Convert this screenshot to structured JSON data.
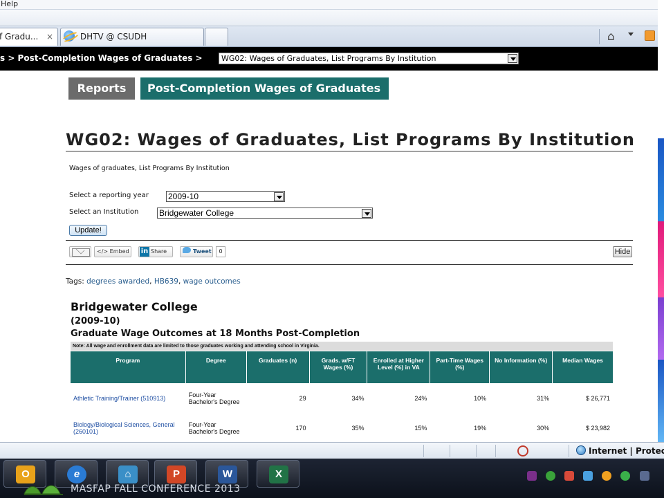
{
  "browser": {
    "menu_help": "Help",
    "tabs": [
      {
        "label": "f Gradu...",
        "close": "×"
      },
      {
        "label": "DHTV @ CSUDH"
      }
    ],
    "breadcrumb": "s  >  Post-Completion Wages of Graduates  >",
    "report_select_value": "WG02: Wages of Graduates, List Programs By Institution",
    "status_zone": "Internet | Protec"
  },
  "nav": {
    "reports": "Reports",
    "wages": "Post-Completion Wages of Graduates"
  },
  "page": {
    "title": "WG02: Wages of Graduates, List Programs By Institution",
    "subtitle": "Wages of graduates, List Programs By Institution",
    "year_label": "Select a reporting year",
    "year_value": "2009-10",
    "institution_label": "Select an Institution",
    "institution_value": "Bridgewater College",
    "update_button": "Update!",
    "share": {
      "embed": "</> Embed",
      "linkedin_icon": "in",
      "share": "Share",
      "tweet": "Tweet",
      "tweet_count": "0",
      "hide": "Hide"
    },
    "tags_label": "Tags:",
    "tags": [
      "degrees awarded",
      "HB639",
      "wage outcomes"
    ]
  },
  "results": {
    "institution": "Bridgewater College",
    "year": "(2009-10)",
    "table_title": "Graduate Wage Outcomes at 18 Months Post-Completion",
    "note": "Note: All wage and enrollment data are limited to those graduates working and attending school in Virginia.",
    "columns": [
      "Program",
      "Degree",
      "Graduates (n)",
      "Grads. w/FT Wages (%)",
      "Enrolled at Higher Level (%) in VA",
      "Part-Time Wages (%)",
      "No Information (%)",
      "Median Wages"
    ],
    "rows": [
      {
        "program": "Athletic Training/Trainer (510913)",
        "degree": "Four-Year Bachelor's Degree",
        "graduates": "29",
        "ft_wages": "34%",
        "enrolled": "24%",
        "part_time": "10%",
        "no_info": "31%",
        "median": "$ 26,771"
      },
      {
        "program": "Biology/Biological Sciences, General (260101)",
        "degree": "Four-Year Bachelor's Degree",
        "graduates": "170",
        "ft_wages": "35%",
        "enrolled": "15%",
        "part_time": "19%",
        "no_info": "30%",
        "median": "$ 23,982"
      }
    ]
  },
  "taskbar": {
    "apps": [
      {
        "name": "outlook-icon",
        "glyph": "O",
        "color": "#e8a21a"
      },
      {
        "name": "internet-explorer-icon",
        "glyph": "e",
        "color": "#2a7bd4"
      },
      {
        "name": "remote-desktop-icon",
        "glyph": "⌂",
        "color": "#3a8fc7"
      },
      {
        "name": "powerpoint-icon",
        "glyph": "P",
        "color": "#d24726"
      },
      {
        "name": "word-icon",
        "glyph": "W",
        "color": "#2b579a"
      },
      {
        "name": "excel-icon",
        "glyph": "X",
        "color": "#217346"
      }
    ],
    "footer_text": "MASFAP FALL CONFERENCE 2013"
  },
  "colors": {
    "teal": "#1b6e6b",
    "gray_tab": "#6b6b6b",
    "link": "#2b5f8f"
  }
}
